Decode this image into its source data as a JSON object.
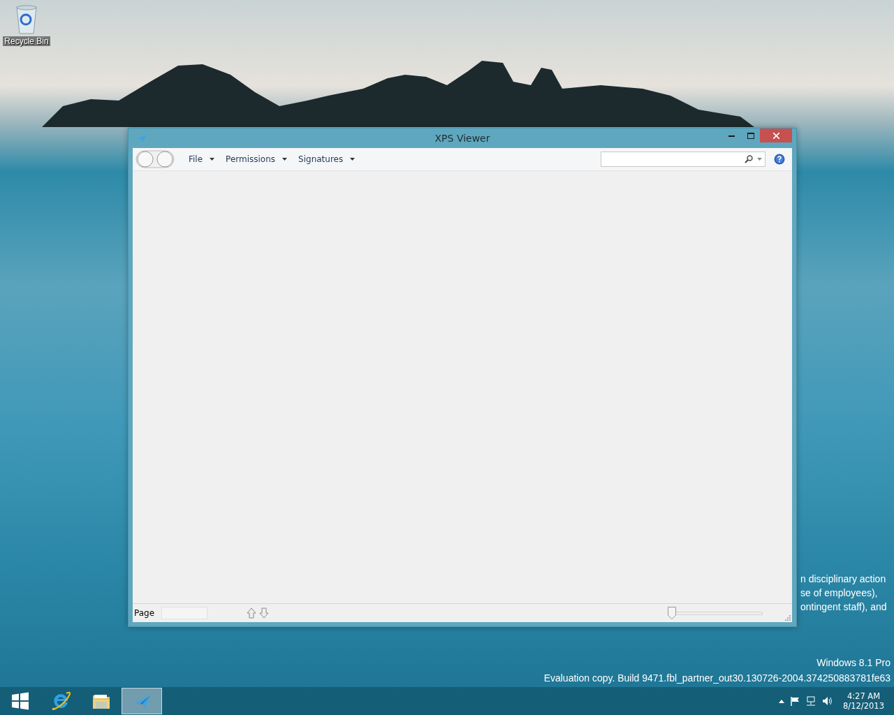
{
  "desktop_icons": [
    {
      "label": "Recycle Bin"
    }
  ],
  "window": {
    "title": "XPS Viewer",
    "menus": [
      {
        "label": "File"
      },
      {
        "label": "Permissions"
      },
      {
        "label": "Signatures"
      }
    ],
    "status_bar": {
      "page_label": "Page",
      "zoom": {
        "level": 0.0
      }
    }
  },
  "desktop_text": {
    "lines": [
      "n disciplinary action",
      "se of employees),",
      "ontingent staff), and"
    ]
  },
  "edition": {
    "name": "Windows 8.1 Pro",
    "build": "Evaluation copy. Build 9471.fbl_partner_out30.130726-2004.374250883781fe63"
  },
  "taskbar": {
    "items": [
      {
        "kind": "start",
        "selected": false
      },
      {
        "kind": "browser",
        "selected": false
      },
      {
        "kind": "folder",
        "selected": false
      },
      {
        "kind": "viewer",
        "selected": true
      }
    ],
    "clock": {
      "time": "4:27 AM",
      "date": "8/12/2013"
    }
  }
}
